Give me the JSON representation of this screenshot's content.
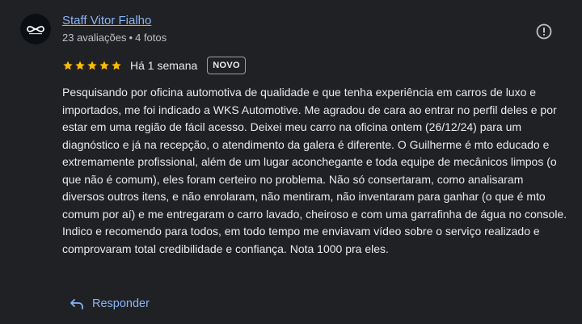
{
  "review": {
    "author_name": "Staff Vitor Fialho",
    "author_meta": {
      "reviews": "23 avaliações",
      "separator": "•",
      "photos": "4 fotos"
    },
    "rating": 5,
    "max_rating": 5,
    "time_ago": "Há 1 semana",
    "badge": "NOVO",
    "text": "Pesquisando por oficina automotiva de qualidade e que tenha experiência em carros de luxo e importados, me foi indicado a WKS Automotive. Me agradou de cara ao entrar no perfil deles e por estar em uma região de fácil acesso. Deixei meu carro na oficina ontem (26/12/24) para um diagnóstico e já na recepção, o atendimento da galera é diferente. O Guilherme é mto educado e extremamente profissional, além de um lugar aconchegante e toda equipe de mecânicos limpos (o que não é comum), eles foram certeiro no problema. Não só consertaram, como analisaram diversos outros itens, e não enrolaram, não mentiram, não inventaram para ganhar (o que é mto comum por aí) e me entregaram o carro lavado, cheiroso e com uma garrafinha de água no console. Indico e recomendo para todos, em todo tempo me enviavam vídeo sobre o serviço realizado e comprovaram total credibilidade e confiança. Nota 1000 pra eles.",
    "reply_label": "Responder"
  },
  "icons": {
    "avatar": "infinity-logo-avatar",
    "info": "info-icon",
    "star": "star-icon",
    "reply": "reply-arrow-icon"
  },
  "colors": {
    "background": "#202124",
    "link": "#8ab4f8",
    "star": "#fbbc04",
    "text": "#e8eaed",
    "secondary_text": "#bdc1c6"
  }
}
